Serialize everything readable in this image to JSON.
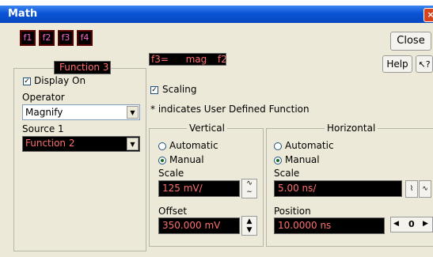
{
  "window": {
    "title": "Math",
    "close_glyph": "×"
  },
  "function_buttons": [
    "f1",
    "f2",
    "f3",
    "f4"
  ],
  "toolbar": {
    "close_label": "Close",
    "help_label": "Help",
    "whats_this": "?"
  },
  "function_group": {
    "title": "Function 3",
    "display_on_label": "Display On",
    "operator_label": "Operator",
    "operator_value": "Magnify",
    "source1_label": "Source 1",
    "source1_value": "Function 2"
  },
  "expression": {
    "lhs": "f3=",
    "op": "mag",
    "arg": "f2"
  },
  "scaling": {
    "label": "Scaling",
    "note": "* indicates User Defined Function"
  },
  "vertical": {
    "title": "Vertical",
    "automatic_label": "Automatic",
    "manual_label": "Manual",
    "scale_label": "Scale",
    "scale_value": "125 mV/",
    "offset_label": "Offset",
    "offset_value": "350.000 mV"
  },
  "horizontal": {
    "title": "Horizontal",
    "automatic_label": "Automatic",
    "manual_label": "Manual",
    "scale_label": "Scale",
    "scale_value": "5.00 ns/",
    "position_label": "Position",
    "position_value": "10.0000 ns",
    "position_step": "0"
  }
}
